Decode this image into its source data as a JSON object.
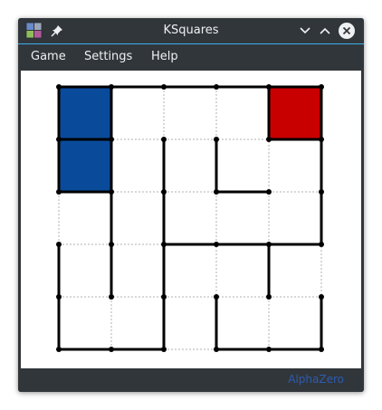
{
  "window": {
    "title": "KSquares"
  },
  "menu": [
    {
      "label": "Game"
    },
    {
      "label": "Settings"
    },
    {
      "label": "Help"
    }
  ],
  "board": {
    "columns": 5,
    "rows": 5,
    "line_color": "#000000",
    "guide_color": "#b0b0b0",
    "filled_squares": [
      {
        "col": 0,
        "row": 0,
        "owner": "blue",
        "color": "#0a4a9a"
      },
      {
        "col": 0,
        "row": 1,
        "owner": "blue",
        "color": "#0a4a9a"
      },
      {
        "col": 4,
        "row": 0,
        "owner": "red",
        "color": "#c80000"
      }
    ],
    "horizontal_lines": [
      [
        0,
        0
      ],
      [
        1,
        0
      ],
      [
        2,
        0
      ],
      [
        3,
        0
      ],
      [
        4,
        0
      ],
      [
        0,
        1
      ],
      [
        4,
        1
      ],
      [
        0,
        2
      ],
      [
        3,
        2
      ],
      [
        2,
        3
      ],
      [
        3,
        3
      ],
      [
        4,
        3
      ],
      [
        0,
        5
      ],
      [
        1,
        5
      ],
      [
        3,
        5
      ],
      [
        4,
        5
      ]
    ],
    "vertical_lines": [
      [
        0,
        0
      ],
      [
        1,
        0
      ],
      [
        4,
        0
      ],
      [
        5,
        0
      ],
      [
        0,
        1
      ],
      [
        1,
        1
      ],
      [
        2,
        1
      ],
      [
        3,
        1
      ],
      [
        5,
        1
      ],
      [
        1,
        2
      ],
      [
        2,
        2
      ],
      [
        5,
        2
      ],
      [
        0,
        3
      ],
      [
        1,
        3
      ],
      [
        2,
        3
      ],
      [
        4,
        3
      ],
      [
        0,
        4
      ],
      [
        2,
        4
      ],
      [
        3,
        4
      ],
      [
        5,
        4
      ]
    ]
  },
  "status": {
    "text": "AlphaZero"
  },
  "colors": {
    "chrome": "#31363b",
    "accent": "#3daee9",
    "blue_player": "#0a4a9a",
    "red_player": "#c80000"
  }
}
